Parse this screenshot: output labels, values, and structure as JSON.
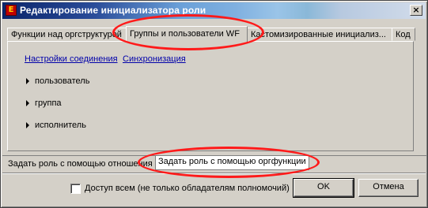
{
  "window": {
    "title": "Редактирование инициализатора роли",
    "icon_glyph": "E",
    "close_glyph": "×"
  },
  "tabs_top": [
    {
      "label": "Функции над оргструктурой"
    },
    {
      "label": "Группы и пользователи WF",
      "active": true
    },
    {
      "label": "Кастомизированные инициализ..."
    },
    {
      "label": "Код"
    }
  ],
  "links": {
    "connection_settings": "Настройки соединения",
    "sync": "Синхронизация"
  },
  "tree_items": [
    {
      "label": "пользователь"
    },
    {
      "label": "группа"
    },
    {
      "label": "исполнитель"
    }
  ],
  "tabs_bottom": [
    {
      "label": "Задать роль с помощью отношения"
    },
    {
      "label": "Задать роль с помощью оргфункции",
      "active": true
    }
  ],
  "footer": {
    "checkbox_label": "Доступ всем (не только обладателям полномочий)",
    "checkbox_checked": false,
    "ok": "OK",
    "cancel": "Отмена"
  },
  "colors": {
    "annotation": "#ff1a1a",
    "titlebar": "#0a246a",
    "link": "#0000aa"
  }
}
